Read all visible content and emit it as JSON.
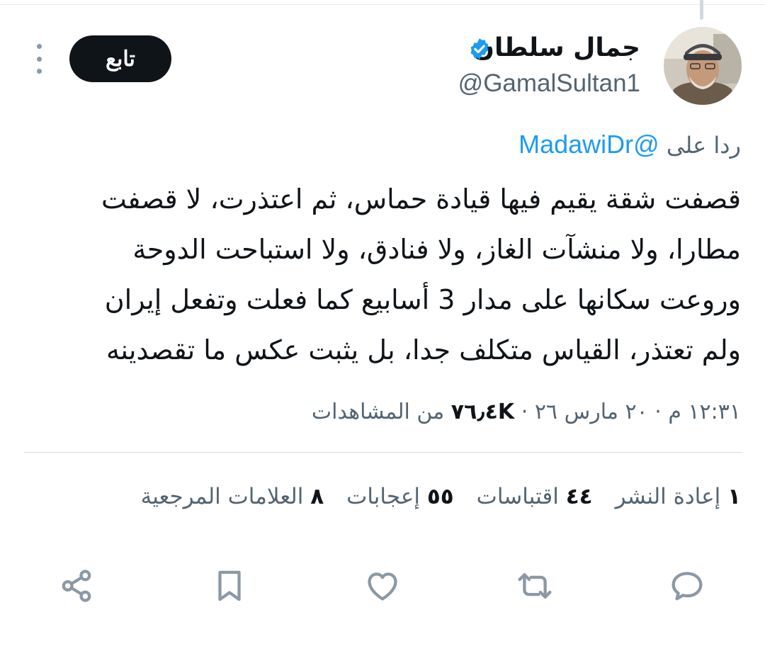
{
  "author": {
    "name": "جمال سلطان",
    "handle": "@GamalSultan1",
    "verified": true,
    "verified_color": "#1d9bf0"
  },
  "follow_button_label": "تابع",
  "reply": {
    "prefix": "ردا على",
    "mention": "@MadawiDr"
  },
  "tweet_text": "قصفت شقة يقيم فيها قيادة حماس، ثم اعتذرت، لا قصفت\nمطارا، ولا منشآت الغاز، ولا فنادق، ولا استباحت الدوحة\nوروعت سكانها على مدار 3 أسابيع كما فعلت وتفعل إيران\nولم تعتذر، القياس متكلف جدا، بل يثبت عكس ما تقصدينه",
  "meta": {
    "time": "١٢:٣١ م",
    "date": "٢٠ مارس ٢٦",
    "separator": "·",
    "views_count": "٧٦٫٤K",
    "views_label": "من المشاهدات"
  },
  "stats": [
    {
      "count": "١",
      "label": "إعادة النشر"
    },
    {
      "count": "٤٤",
      "label": "اقتباسات"
    },
    {
      "count": "٥٥",
      "label": "إعجابات"
    },
    {
      "count": "٨",
      "label": "العلامات المرجعية"
    }
  ],
  "actions": [
    "reply-icon",
    "retweet-icon",
    "like-icon",
    "bookmark-icon",
    "share-icon"
  ],
  "colors": {
    "text": "#0f1419",
    "secondary": "#536471",
    "accent": "#1d9bf0",
    "icon": "#8b98a5"
  }
}
